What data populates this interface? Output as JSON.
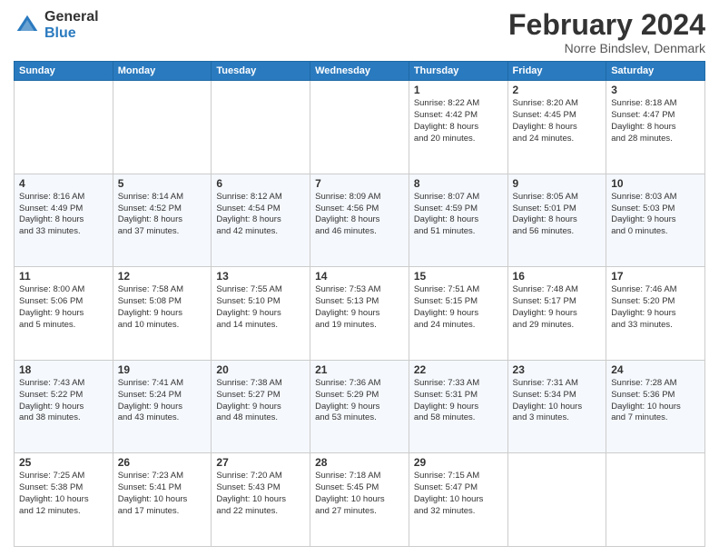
{
  "header": {
    "logo": {
      "general": "General",
      "blue": "Blue"
    },
    "title": "February 2024",
    "location": "Norre Bindslev, Denmark"
  },
  "calendar": {
    "days": [
      "Sunday",
      "Monday",
      "Tuesday",
      "Wednesday",
      "Thursday",
      "Friday",
      "Saturday"
    ],
    "weeks": [
      [
        {
          "day": "",
          "info": ""
        },
        {
          "day": "",
          "info": ""
        },
        {
          "day": "",
          "info": ""
        },
        {
          "day": "",
          "info": ""
        },
        {
          "day": "1",
          "info": "Sunrise: 8:22 AM\nSunset: 4:42 PM\nDaylight: 8 hours\nand 20 minutes."
        },
        {
          "day": "2",
          "info": "Sunrise: 8:20 AM\nSunset: 4:45 PM\nDaylight: 8 hours\nand 24 minutes."
        },
        {
          "day": "3",
          "info": "Sunrise: 8:18 AM\nSunset: 4:47 PM\nDaylight: 8 hours\nand 28 minutes."
        }
      ],
      [
        {
          "day": "4",
          "info": "Sunrise: 8:16 AM\nSunset: 4:49 PM\nDaylight: 8 hours\nand 33 minutes."
        },
        {
          "day": "5",
          "info": "Sunrise: 8:14 AM\nSunset: 4:52 PM\nDaylight: 8 hours\nand 37 minutes."
        },
        {
          "day": "6",
          "info": "Sunrise: 8:12 AM\nSunset: 4:54 PM\nDaylight: 8 hours\nand 42 minutes."
        },
        {
          "day": "7",
          "info": "Sunrise: 8:09 AM\nSunset: 4:56 PM\nDaylight: 8 hours\nand 46 minutes."
        },
        {
          "day": "8",
          "info": "Sunrise: 8:07 AM\nSunset: 4:59 PM\nDaylight: 8 hours\nand 51 minutes."
        },
        {
          "day": "9",
          "info": "Sunrise: 8:05 AM\nSunset: 5:01 PM\nDaylight: 8 hours\nand 56 minutes."
        },
        {
          "day": "10",
          "info": "Sunrise: 8:03 AM\nSunset: 5:03 PM\nDaylight: 9 hours\nand 0 minutes."
        }
      ],
      [
        {
          "day": "11",
          "info": "Sunrise: 8:00 AM\nSunset: 5:06 PM\nDaylight: 9 hours\nand 5 minutes."
        },
        {
          "day": "12",
          "info": "Sunrise: 7:58 AM\nSunset: 5:08 PM\nDaylight: 9 hours\nand 10 minutes."
        },
        {
          "day": "13",
          "info": "Sunrise: 7:55 AM\nSunset: 5:10 PM\nDaylight: 9 hours\nand 14 minutes."
        },
        {
          "day": "14",
          "info": "Sunrise: 7:53 AM\nSunset: 5:13 PM\nDaylight: 9 hours\nand 19 minutes."
        },
        {
          "day": "15",
          "info": "Sunrise: 7:51 AM\nSunset: 5:15 PM\nDaylight: 9 hours\nand 24 minutes."
        },
        {
          "day": "16",
          "info": "Sunrise: 7:48 AM\nSunset: 5:17 PM\nDaylight: 9 hours\nand 29 minutes."
        },
        {
          "day": "17",
          "info": "Sunrise: 7:46 AM\nSunset: 5:20 PM\nDaylight: 9 hours\nand 33 minutes."
        }
      ],
      [
        {
          "day": "18",
          "info": "Sunrise: 7:43 AM\nSunset: 5:22 PM\nDaylight: 9 hours\nand 38 minutes."
        },
        {
          "day": "19",
          "info": "Sunrise: 7:41 AM\nSunset: 5:24 PM\nDaylight: 9 hours\nand 43 minutes."
        },
        {
          "day": "20",
          "info": "Sunrise: 7:38 AM\nSunset: 5:27 PM\nDaylight: 9 hours\nand 48 minutes."
        },
        {
          "day": "21",
          "info": "Sunrise: 7:36 AM\nSunset: 5:29 PM\nDaylight: 9 hours\nand 53 minutes."
        },
        {
          "day": "22",
          "info": "Sunrise: 7:33 AM\nSunset: 5:31 PM\nDaylight: 9 hours\nand 58 minutes."
        },
        {
          "day": "23",
          "info": "Sunrise: 7:31 AM\nSunset: 5:34 PM\nDaylight: 10 hours\nand 3 minutes."
        },
        {
          "day": "24",
          "info": "Sunrise: 7:28 AM\nSunset: 5:36 PM\nDaylight: 10 hours\nand 7 minutes."
        }
      ],
      [
        {
          "day": "25",
          "info": "Sunrise: 7:25 AM\nSunset: 5:38 PM\nDaylight: 10 hours\nand 12 minutes."
        },
        {
          "day": "26",
          "info": "Sunrise: 7:23 AM\nSunset: 5:41 PM\nDaylight: 10 hours\nand 17 minutes."
        },
        {
          "day": "27",
          "info": "Sunrise: 7:20 AM\nSunset: 5:43 PM\nDaylight: 10 hours\nand 22 minutes."
        },
        {
          "day": "28",
          "info": "Sunrise: 7:18 AM\nSunset: 5:45 PM\nDaylight: 10 hours\nand 27 minutes."
        },
        {
          "day": "29",
          "info": "Sunrise: 7:15 AM\nSunset: 5:47 PM\nDaylight: 10 hours\nand 32 minutes."
        },
        {
          "day": "",
          "info": ""
        },
        {
          "day": "",
          "info": ""
        }
      ]
    ]
  }
}
